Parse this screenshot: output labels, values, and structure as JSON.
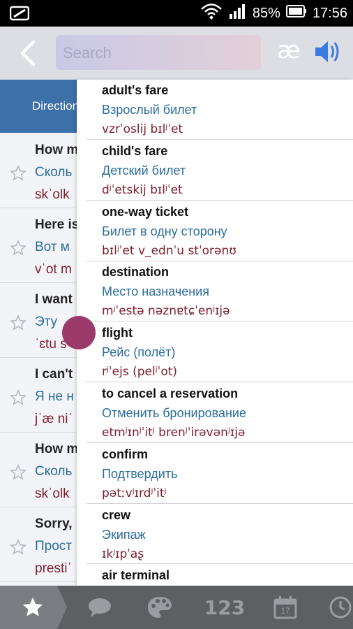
{
  "status_bar": {
    "battery": "85%",
    "time": "17:56"
  },
  "toolbar": {
    "search_placeholder": "Search",
    "ae_label": "æ"
  },
  "background": {
    "header": "Direction",
    "rows": [
      {
        "phrase": "How m",
        "russian": "Сколь",
        "phonetic": "skˈolk"
      },
      {
        "phrase": "Here is",
        "russian": "Вот м",
        "phonetic": "vˈot m"
      },
      {
        "phrase": "I want",
        "russian": "Эту",
        "phonetic": "ˈɛtu s"
      },
      {
        "phrase": "I can't",
        "russian": "Я не н",
        "phonetic": "jˈæ niˈ"
      },
      {
        "phrase": "How m",
        "russian": "Сколь",
        "phonetic": "skˈolk"
      },
      {
        "phrase": "Sorry,",
        "russian": "Прост",
        "phonetic": "prestiˈ"
      }
    ]
  },
  "dropdown": {
    "items": [
      {
        "word": "adult's fare",
        "russian": "Взрослый билет",
        "phonetic": "vzrˈoslij bɪlʲˈet"
      },
      {
        "word": "child's fare",
        "russian": "Детский билет",
        "phonetic": "dʲˈetskij bɪlʲˈet"
      },
      {
        "word": "one-way ticket",
        "russian": "Билет в одну сторону",
        "phonetic": "bɪlʲˈet v_ednˈu stˈorənʊ"
      },
      {
        "word": "destination",
        "russian": "Место назначения",
        "phonetic": "mʲˈestə nəznɐtɕˈenʲɪjə"
      },
      {
        "word": "flight",
        "russian": "Рейс (полёт)",
        "phonetic": "rʲˈejs (pelʲˈot)"
      },
      {
        "word": "to cancel a reservation",
        "russian": "Отменить бронирование",
        "phonetic": "etmʲɪnʲˈitʲ brenʲˈirəvənʲɪjə"
      },
      {
        "word": "confirm",
        "russian": "Подтвердить",
        "phonetic": "pətːvʲɪrdʲˈitʲ"
      },
      {
        "word": "crew",
        "russian": "Экипаж",
        "phonetic": "ɪkʲɪpˈaʂ"
      },
      {
        "word": "air terminal",
        "russian": "",
        "phonetic": ""
      }
    ]
  },
  "bottom_tabs": {
    "items": [
      {
        "name": "favorites",
        "icon": "star-icon"
      },
      {
        "name": "chat",
        "icon": "speech-bubble-icon"
      },
      {
        "name": "palette",
        "icon": "palette-icon"
      },
      {
        "name": "numbers",
        "icon": "numbers-icon",
        "label": "123"
      },
      {
        "name": "calendar",
        "icon": "calendar-icon",
        "label": "17"
      },
      {
        "name": "time",
        "icon": "clock-icon"
      }
    ]
  },
  "colors": {
    "accent_blue": "#3d6fa8",
    "russian_text": "#2b6d9c",
    "phonetic_text": "#7c1d2e",
    "handle": "#9b3a68"
  }
}
